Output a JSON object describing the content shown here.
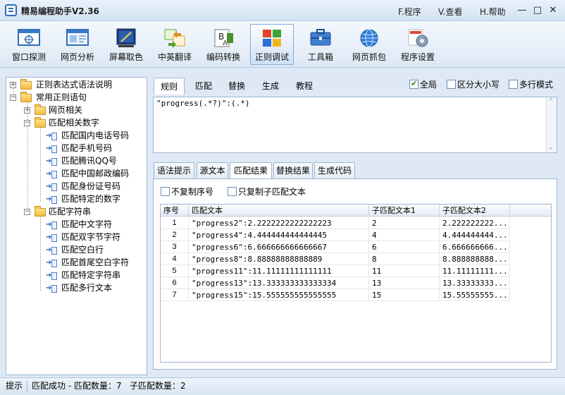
{
  "titlebar": {
    "title": "精易编程助手V2.36",
    "menus": [
      "F.程序",
      "V.查看",
      "H.帮助"
    ],
    "buttons": {
      "minimize": "—",
      "maximize": "□",
      "close": "✕"
    }
  },
  "toolbar": {
    "items": [
      {
        "label": "窗口探测",
        "icon": "window-probe-icon"
      },
      {
        "label": "网页分析",
        "icon": "web-analyze-icon"
      },
      {
        "label": "屏幕取色",
        "icon": "color-picker-icon"
      },
      {
        "label": "中英翻译",
        "icon": "translate-icon"
      },
      {
        "label": "编码转换",
        "icon": "encoding-icon"
      },
      {
        "label": "正则调试",
        "icon": "regex-icon",
        "active": true
      },
      {
        "label": "工具箱",
        "icon": "toolbox-icon"
      },
      {
        "label": "网页抓包",
        "icon": "globe-icon"
      },
      {
        "label": "程序设置",
        "icon": "settings-icon"
      }
    ]
  },
  "tree": {
    "n0": "正则表达式语法说明",
    "n1": "常用正则语句",
    "n2": "网页相关",
    "n3": "匹配相关数字",
    "n4": "匹配国内电话号码",
    "n5": "匹配手机号码",
    "n6": "匹配腾讯QQ号",
    "n7": "匹配中国邮政编码",
    "n8": "匹配身份证号码",
    "n9": "匹配特定的数字",
    "n10": "匹配字符串",
    "n11": "匹配中文字符",
    "n12": "匹配双字节字符",
    "n13": "匹配空白行",
    "n14": "匹配首尾空白字符",
    "n15": "匹配特定字符串",
    "n16": "匹配多行文本"
  },
  "top_tabs": [
    "规则",
    "匹配",
    "替换",
    "生成",
    "教程"
  ],
  "options": {
    "global": "全局",
    "case": "区分大小写",
    "multiline": "多行模式"
  },
  "regex": "\"progress(.*?)\":(.*)",
  "bottom_tabs": [
    "语法提示",
    "源文本",
    "匹配结果",
    "替换结果",
    "生成代码"
  ],
  "result_options": {
    "no_copy_index": "不复制序号",
    "copy_sub_only": "只复制子匹配文本"
  },
  "grid": {
    "headers": [
      "序号",
      "匹配文本",
      "子匹配文本1",
      "子匹配文本2"
    ],
    "rows": [
      [
        "1",
        "\"progress2\":2.2222222222222223",
        "2",
        "2.222222222..."
      ],
      [
        "2",
        "\"progress4\":4.444444444444445",
        "4",
        "4.444444444..."
      ],
      [
        "3",
        "\"progress6\":6.666666666666667",
        "6",
        "6.666666666..."
      ],
      [
        "4",
        "\"progress8\":8.88888888888889",
        "8",
        "8.888888888..."
      ],
      [
        "5",
        "\"progress11\":11.11111111111111",
        "11",
        "11.11111111..."
      ],
      [
        "6",
        "\"progress13\":13.333333333333334",
        "13",
        "13.33333333..."
      ],
      [
        "7",
        "\"progress15\":15.555555555555555",
        "15",
        "15.55555555..."
      ]
    ]
  },
  "status": {
    "label": "提示",
    "text": "匹配成功 - 匹配数量：7   子匹配数量：2"
  }
}
